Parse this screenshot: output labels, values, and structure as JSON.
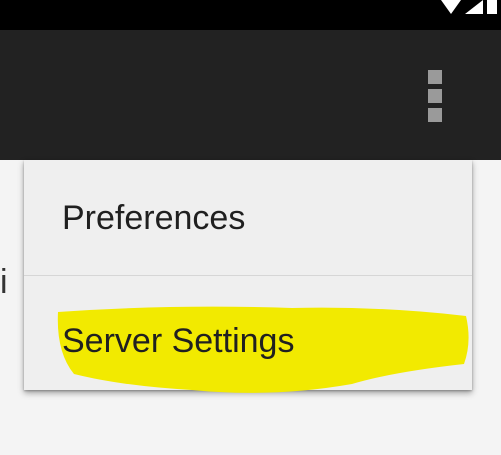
{
  "colors": {
    "status_bar": "#000000",
    "app_bar": "#222222",
    "menu_background": "#efefef",
    "highlight": "#f2ea00",
    "overflow_icon": "#9a9a9a"
  },
  "app_bar": {
    "overflow_icon": "more-vert-icon"
  },
  "menu": {
    "items": [
      {
        "label": "Preferences"
      },
      {
        "label": "Server Settings",
        "highlighted": true
      }
    ]
  },
  "background": {
    "partial_text": "i"
  }
}
